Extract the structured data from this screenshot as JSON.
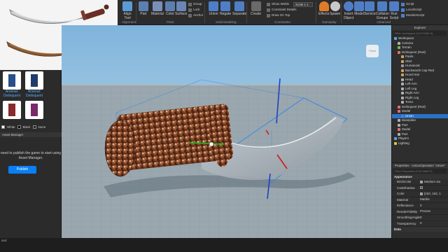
{
  "ribbon": {
    "buttons": [
      {
        "label": "Align Tool",
        "icon": "align-icon",
        "color": "#5b9bd5"
      },
      {
        "label": "Part",
        "icon": "part-icon",
        "color": "#5d7fb0"
      },
      {
        "label": "Material",
        "icon": "material-icon",
        "color": "#7a8fb8"
      },
      {
        "label": "Color",
        "icon": "color-icon",
        "color": "#5d7fb0"
      },
      {
        "label": "Surface",
        "icon": "surface-icon",
        "color": "#6a87b5"
      },
      {
        "label": "Union",
        "icon": "union-icon",
        "color": "#4f7ec7"
      },
      {
        "label": "Negate",
        "icon": "negate-icon",
        "color": "#4f7ec7"
      },
      {
        "label": "Separate",
        "icon": "separate-icon",
        "color": "#4f7ec7"
      },
      {
        "label": "Create",
        "icon": "create-icon",
        "color": "#6a6a6a"
      },
      {
        "label": "Effects",
        "icon": "effects-icon",
        "color": "#e07b2a"
      },
      {
        "label": "Spawn",
        "icon": "spawn-icon",
        "color": "#c9c9c9"
      },
      {
        "label": "Insert Object",
        "icon": "insert-object-icon",
        "color": "#4f7ec7"
      },
      {
        "label": "Model",
        "icon": "model-icon",
        "color": "#4f7ec7"
      },
      {
        "label": "Service",
        "icon": "service-icon",
        "color": "#4f7ec7"
      },
      {
        "label": "Collision Groups",
        "icon": "collision-groups-icon",
        "color": "#4f7ec7"
      },
      {
        "label": "Run Script",
        "icon": "run-script-icon",
        "color": "#4f7ec7"
      }
    ],
    "small_items": {
      "group": "Group",
      "lock": "Lock",
      "anchor": "Anchor",
      "show_welds": "Show Welds",
      "constraint_details": "Constraint Details",
      "draw_on_top": "Draw On Top",
      "scale_label": "Scale",
      "scale_value": "1 x",
      "script": "Script",
      "local_script": "LocalScript",
      "module_script": "ModuleScript"
    },
    "groups": {
      "alignment": "Alignment",
      "parts": "Parts",
      "solid_modeling": "Solid Modeling",
      "constraints": "Constraints",
      "gameplay": "Gameplay",
      "advanced": "Advanced"
    }
  },
  "toolbox": {
    "items": [
      {
        "label": "Arsenal: Delinquent",
        "color": "#2a4f8a"
      },
      {
        "label": "Arsenal: Delinquent",
        "color": "#1f3d6b"
      }
    ],
    "colors": [
      "White",
      "Black",
      "None"
    ],
    "asset_manager": {
      "title": "Asset Manager",
      "message": "need to publish the game to start using Asset Manager.",
      "publish_label": "Publish"
    }
  },
  "viewport": {
    "viewcube_label": "Front"
  },
  "explorer": {
    "title": "Explorer",
    "filter_placeholder": "Filter workspace (Ctrl+Shift+X)",
    "items": [
      {
        "label": "Workspace",
        "icon_color": "#5aa0e0"
      },
      {
        "label": "Camera",
        "icon_color": "#b0b0b0"
      },
      {
        "label": "Terrain",
        "icon_color": "#6fbf4f"
      },
      {
        "label": "Delinquent (Red)",
        "icon_color": "#e07070"
      },
      {
        "label": "Pants",
        "icon_color": "#cfa060"
      },
      {
        "label": "Shirt",
        "icon_color": "#cfa060"
      },
      {
        "label": "Humanoid",
        "icon_color": "#9a9a9a"
      },
      {
        "label": "Backwards Cap Red",
        "icon_color": "#cfa060"
      },
      {
        "label": "Hood Hair",
        "icon_color": "#cfa060"
      },
      {
        "label": "Head",
        "icon_color": "#b0b0b0"
      },
      {
        "label": "Left Arm",
        "icon_color": "#b0b0b0"
      },
      {
        "label": "Left Leg",
        "icon_color": "#b0b0b0"
      },
      {
        "label": "Right Arm",
        "icon_color": "#b0b0b0"
      },
      {
        "label": "Right Leg",
        "icon_color": "#b0b0b0"
      },
      {
        "label": "Torso",
        "icon_color": "#b0b0b0"
      },
      {
        "label": "Delinquent (Red)",
        "icon_color": "#e07070"
      },
      {
        "label": "Model",
        "icon_color": "#e07070"
      },
      {
        "label": "Union",
        "icon_color": "#4f7ec7",
        "selected": true
      },
      {
        "label": "Baseplate",
        "icon_color": "#b0b0b0"
      },
      {
        "label": "Part",
        "icon_color": "#b0b0b0"
      },
      {
        "label": "Model",
        "icon_color": "#e07070"
      },
      {
        "label": "Part",
        "icon_color": "#b0b0b0"
      },
      {
        "label": "Players",
        "icon_color": "#5aa0e0"
      },
      {
        "label": "Lighting",
        "icon_color": "#e0c040"
      }
    ]
  },
  "properties": {
    "title": "Properties - UnionOperation \"Union\"",
    "filter_placeholder": "Filter Properties (Ctrl+Shift+P)",
    "sections": [
      {
        "name": "Appearance",
        "rows": [
          {
            "name": "BrickColor",
            "value": "Medium sto",
            "swatch": "#a3a2a5"
          },
          {
            "name": "CastShadow",
            "value": "",
            "check": true
          },
          {
            "name": "Color",
            "value": "[163, 162, 1",
            "swatch": "#a3a2a5"
          },
          {
            "name": "Material",
            "value": "Marble"
          },
          {
            "name": "Reflectance",
            "value": "0"
          },
          {
            "name": "RenderFidelity",
            "value": "Precise"
          },
          {
            "name": "SmoothingAngle",
            "value": "0"
          },
          {
            "name": "Transparency",
            "value": "0"
          }
        ]
      },
      {
        "name": "Data",
        "rows": []
      }
    ]
  },
  "status": {
    "text": "and"
  }
}
